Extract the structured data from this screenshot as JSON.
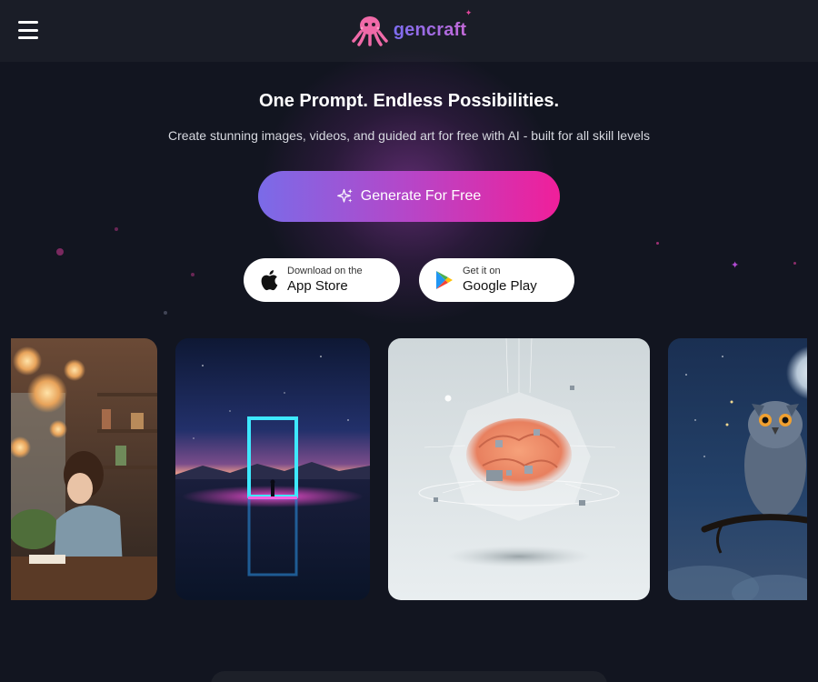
{
  "header": {
    "menu_icon": "hamburger-menu-icon",
    "logo_icon": "octopus-logo-icon",
    "logo_text": "gencraft"
  },
  "hero": {
    "title": "One Prompt. Endless Possibilities.",
    "subtitle": "Create stunning images, videos, and guided art for free with AI - built for all skill levels",
    "cta_icon": "sparkles-icon",
    "cta_label": "Generate For Free"
  },
  "stores": {
    "apple": {
      "icon": "apple-icon",
      "small": "Download on the",
      "big": "App Store"
    },
    "google": {
      "icon": "google-play-icon",
      "small": "Get it on",
      "big": "Google Play"
    }
  },
  "gallery": {
    "items": [
      {
        "subject": "cafe-girl-lanterns-image"
      },
      {
        "subject": "neon-portal-lake-image"
      },
      {
        "subject": "crystal-brain-image"
      },
      {
        "subject": "owl-moonlight-image"
      }
    ]
  },
  "colors": {
    "background": "#121520",
    "topbar": "#1a1d27",
    "cta_start": "#7a6be8",
    "cta_end": "#f01f9a",
    "accent_pink": "#e0459b"
  }
}
